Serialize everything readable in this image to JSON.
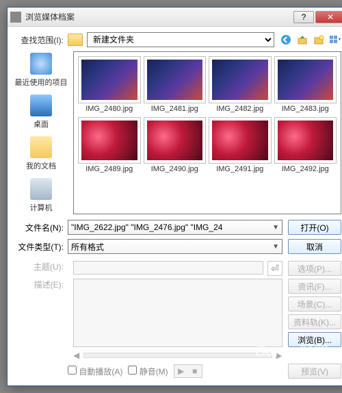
{
  "titlebar": {
    "title": "浏览媒体档案"
  },
  "lookin": {
    "label": "查找范围(I):",
    "folder": "新建文件夹",
    "icons": {
      "back": "back-icon",
      "up": "up-icon",
      "newfolder": "newfolder-icon",
      "view": "view-icon"
    }
  },
  "places": [
    {
      "id": "recent",
      "label": "最近使用的项目"
    },
    {
      "id": "desktop",
      "label": "桌面"
    },
    {
      "id": "docs",
      "label": "我的文档"
    },
    {
      "id": "computer",
      "label": "计算机"
    }
  ],
  "files": {
    "row1": [
      {
        "name": "IMG_2480.jpg",
        "style": "stage"
      },
      {
        "name": "IMG_2481.jpg",
        "style": "stage"
      },
      {
        "name": "IMG_2482.jpg",
        "style": "stage"
      },
      {
        "name": "IMG_2483.jpg",
        "style": "stage"
      }
    ],
    "row2": [
      {
        "name": "IMG_2489.jpg",
        "style": "red"
      },
      {
        "name": "IMG_2490.jpg",
        "style": "red"
      },
      {
        "name": "IMG_2491.jpg",
        "style": "red"
      },
      {
        "name": "IMG_2492.jpg",
        "style": "red"
      }
    ]
  },
  "form": {
    "filename_label": "文件名(N):",
    "filename_value": "\"IMG_2622.jpg\" \"IMG_2476.jpg\" \"IMG_24",
    "filetype_label": "文件类型(T):",
    "filetype_value": "所有格式",
    "open_label": "打开(O)",
    "cancel_label": "取消"
  },
  "extra": {
    "subject_label": "主题(U):",
    "desc_label": "描述(E):",
    "options": "选项(P)...",
    "info": "资讯(F)...",
    "scene": "场景(C)...",
    "datatrack": "资料轨(K)...",
    "browse": "浏览(B)...",
    "preview": "预览(V)",
    "autoplay": "自動播放(A)",
    "mute": "静音(M)"
  },
  "watermark": "Baidu经验"
}
